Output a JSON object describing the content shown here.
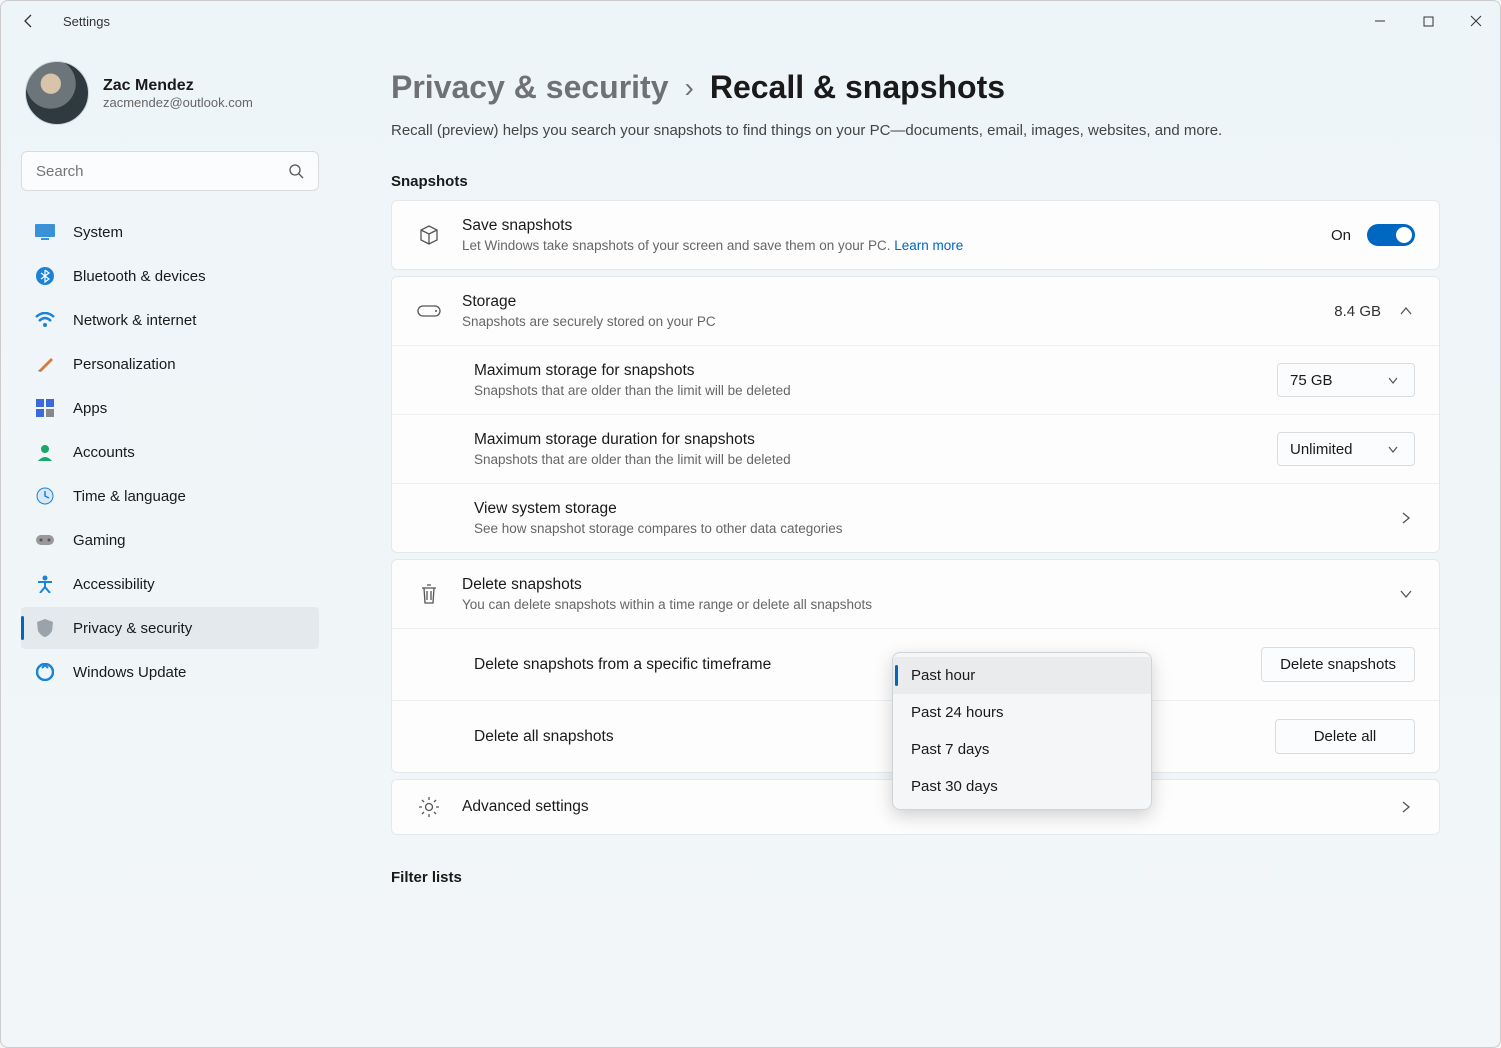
{
  "window": {
    "title": "Settings"
  },
  "profile": {
    "name": "Zac Mendez",
    "email": "zacmendez@outlook.com"
  },
  "search": {
    "placeholder": "Search"
  },
  "nav": {
    "items": [
      {
        "label": "System"
      },
      {
        "label": "Bluetooth & devices"
      },
      {
        "label": "Network & internet"
      },
      {
        "label": "Personalization"
      },
      {
        "label": "Apps"
      },
      {
        "label": "Accounts"
      },
      {
        "label": "Time & language"
      },
      {
        "label": "Gaming"
      },
      {
        "label": "Accessibility"
      },
      {
        "label": "Privacy & security"
      },
      {
        "label": "Windows Update"
      }
    ]
  },
  "breadcrumb": {
    "parent": "Privacy & security",
    "current": "Recall & snapshots"
  },
  "description": "Recall (preview) helps you search your snapshots to find things on your PC—documents, email, images, websites, and more.",
  "sections": {
    "snapshots_title": "Snapshots",
    "filter_title": "Filter lists"
  },
  "save_snapshots": {
    "title": "Save snapshots",
    "subtitle": "Let Windows take snapshots of your screen and save them on your PC. ",
    "learn_more": "Learn more",
    "toggle_label": "On"
  },
  "storage": {
    "title": "Storage",
    "subtitle": "Snapshots are securely stored on your PC",
    "size": "8.4 GB",
    "max_storage": {
      "title": "Maximum storage for snapshots",
      "subtitle": "Snapshots that are older than the limit will be deleted",
      "value": "75 GB"
    },
    "max_duration": {
      "title": "Maximum storage duration for snapshots",
      "subtitle": "Snapshots that are older than the limit will be deleted",
      "value": "Unlimited"
    },
    "view_system": {
      "title": "View system storage",
      "subtitle": "See how snapshot storage compares to other data categories"
    }
  },
  "delete": {
    "title": "Delete snapshots",
    "subtitle": "You can delete snapshots within a time range or delete all snapshots",
    "timeframe": {
      "title": "Delete snapshots from a specific timeframe",
      "button": "Delete snapshots"
    },
    "all": {
      "title": "Delete all snapshots",
      "button": "Delete all"
    }
  },
  "dropdown": {
    "options": [
      "Past hour",
      "Past 24 hours",
      "Past 7 days",
      "Past 30 days"
    ],
    "selected_index": 0
  },
  "advanced": {
    "title": "Advanced settings"
  }
}
